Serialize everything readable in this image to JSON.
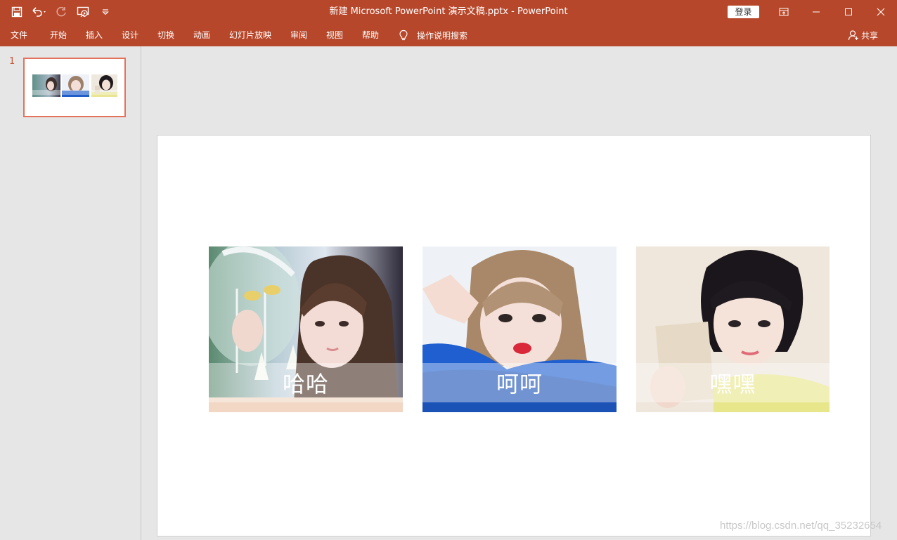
{
  "window": {
    "title": "新建 Microsoft PowerPoint 演示文稿.pptx  -  PowerPoint",
    "login_label": "登录",
    "titlebar_color": "#b7472a"
  },
  "quick_access": [
    "save-icon",
    "undo-icon",
    "redo-icon",
    "slideshow-icon",
    "customize-icon"
  ],
  "ribbon": {
    "tabs": [
      "文件",
      "开始",
      "插入",
      "设计",
      "切换",
      "动画",
      "幻灯片放映",
      "审阅",
      "视图",
      "帮助"
    ],
    "tell_me": "操作说明搜索",
    "share": "共享"
  },
  "slides_pane": {
    "slide_number": "1"
  },
  "slide": {
    "photos": [
      {
        "caption": "哈哈",
        "palette": "cyan-white"
      },
      {
        "caption": "呵呵",
        "palette": "blue"
      },
      {
        "caption": "嘿嘿",
        "palette": "yellow"
      }
    ]
  },
  "watermark": "https://blog.csdn.net/qq_35232654"
}
